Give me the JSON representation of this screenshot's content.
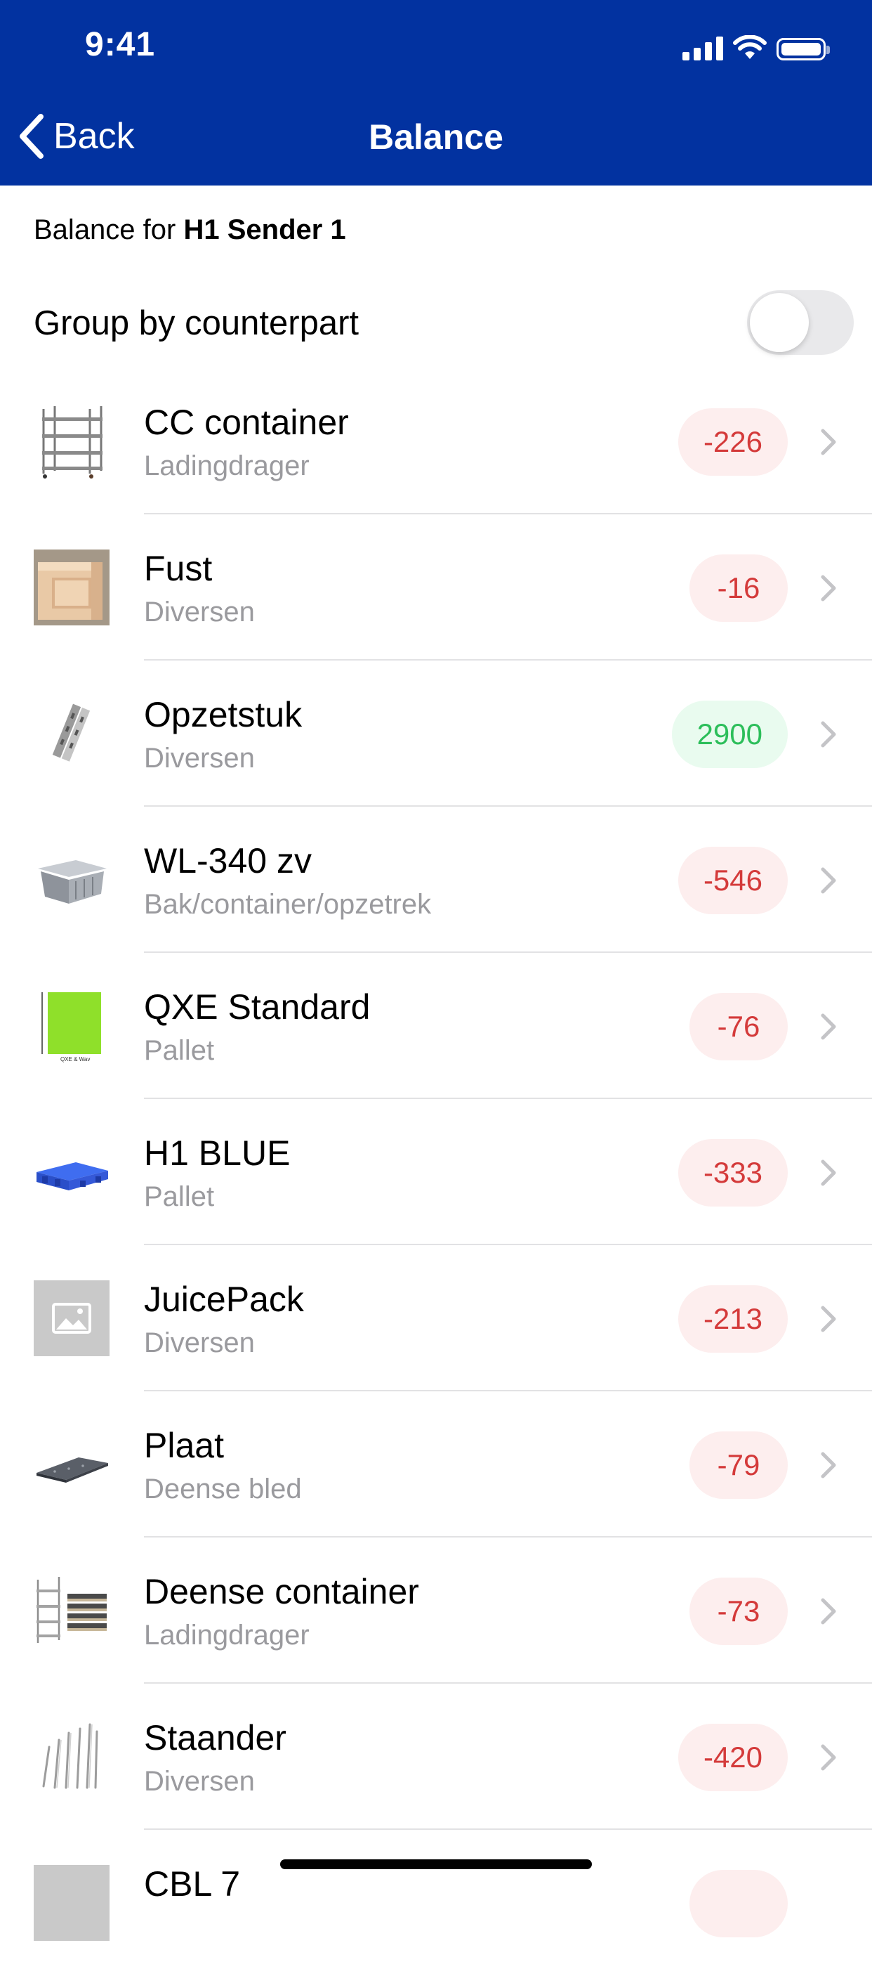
{
  "status_bar": {
    "time": "9:41"
  },
  "nav": {
    "back_label": "Back",
    "title": "Balance"
  },
  "balance_for": {
    "prefix": "Balance for ",
    "name": "H1 Sender 1"
  },
  "group_toggle": {
    "label": "Group by counterpart",
    "on": false
  },
  "colors": {
    "header": "#0232a0",
    "negative": "#d43a3a",
    "positive": "#2cbe5a"
  },
  "items": [
    {
      "name": "CC container",
      "category": "Ladingdrager",
      "value": "-226",
      "sign": "neg",
      "icon": "cc-container-image"
    },
    {
      "name": "Fust",
      "category": "Diversen",
      "value": "-16",
      "sign": "neg",
      "icon": "crate-image"
    },
    {
      "name": "Opzetstuk",
      "category": "Diversen",
      "value": "2900",
      "sign": "pos",
      "icon": "bracket-image"
    },
    {
      "name": "WL-340 zv",
      "category": "Bak/container/opzetrek",
      "value": "-546",
      "sign": "neg",
      "icon": "plastic-bin-image"
    },
    {
      "name": "QXE Standard",
      "category": "Pallet",
      "value": "-76",
      "sign": "neg",
      "icon": "green-sheet-image"
    },
    {
      "name": "H1 BLUE",
      "category": "Pallet",
      "value": "-333",
      "sign": "neg",
      "icon": "blue-pallet-image"
    },
    {
      "name": "JuicePack",
      "category": "Diversen",
      "value": "-213",
      "sign": "neg",
      "icon": "placeholder-image"
    },
    {
      "name": "Plaat",
      "category": "Deense bled",
      "value": "-79",
      "sign": "neg",
      "icon": "plate-image"
    },
    {
      "name": "Deense container",
      "category": "Ladingdrager",
      "value": "-73",
      "sign": "neg",
      "icon": "danish-trolley-image"
    },
    {
      "name": "Staander",
      "category": "Diversen",
      "value": "-420",
      "sign": "neg",
      "icon": "poles-image"
    },
    {
      "name": "CBL 7",
      "category": "",
      "value": "",
      "sign": "neg",
      "icon": "placeholder-image"
    }
  ],
  "thumb_text": {
    "qxe_small": "QXE & Wav"
  }
}
